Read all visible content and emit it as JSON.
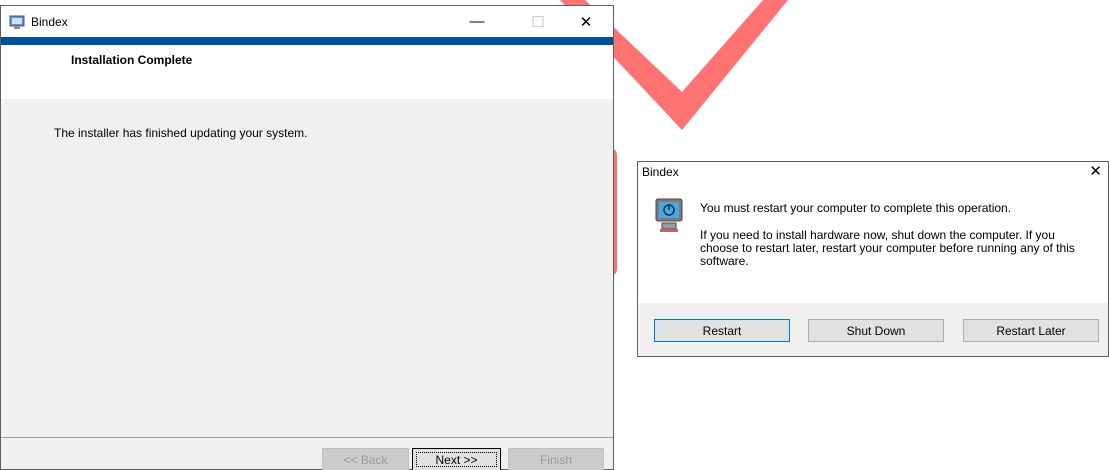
{
  "installer": {
    "title": "Bindex",
    "header_title": "Installation Complete",
    "message": "The installer has finished updating your system.",
    "buttons": {
      "back": "<< Back",
      "next": "Next >>",
      "finish": "Finish"
    },
    "caption": {
      "minimize": "—",
      "maximize": "☐",
      "close": "✕"
    },
    "accent_color": "#0050a0"
  },
  "dialog": {
    "title": "Bindex",
    "close": "✕",
    "message_primary": "You must restart your computer to complete this operation.",
    "message_secondary": "If you need to install hardware now, shut down the computer. If you choose to restart later, restart your computer before running any of this software.",
    "buttons": {
      "restart": "Restart",
      "shut_down": "Shut Down",
      "restart_later": "Restart Later"
    },
    "icon": "power-monitor-icon"
  },
  "decoration": {
    "checkmark_color": "#ff6b6b"
  }
}
